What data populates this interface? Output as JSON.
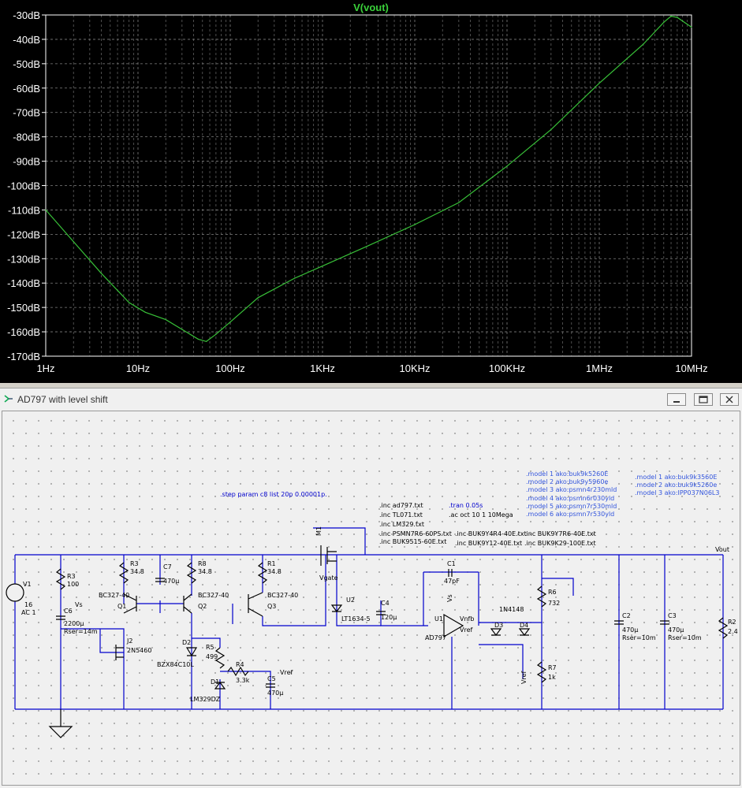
{
  "plot": {
    "title": "V(vout)",
    "trace_color": "#38c038",
    "background": "#000000",
    "y_ticks": [
      "-30dB",
      "-40dB",
      "-50dB",
      "-60dB",
      "-70dB",
      "-80dB",
      "-90dB",
      "-100dB",
      "-110dB",
      "-120dB",
      "-130dB",
      "-140dB",
      "-150dB",
      "-160dB",
      "-170dB"
    ],
    "x_ticks": [
      "1Hz",
      "10Hz",
      "100Hz",
      "1KHz",
      "10KHz",
      "100KHz",
      "1MHz",
      "10MHz"
    ]
  },
  "chart_data": {
    "type": "line",
    "title": "V(vout)",
    "xlabel": "",
    "ylabel": "",
    "x_scale": "log",
    "xlim": [
      1,
      10000000
    ],
    "ylim": [
      -170,
      -30
    ],
    "grid": true,
    "series": [
      {
        "name": "V(vout)",
        "x": [
          1,
          2,
          4,
          8,
          12,
          20,
          30,
          45,
          55,
          70,
          100,
          200,
          500,
          1000,
          3000,
          10000,
          30000,
          100000,
          300000,
          1000000,
          3000000,
          5000000,
          6000000,
          7000000,
          10000000
        ],
        "y": [
          -110,
          -123,
          -136,
          -148,
          -152,
          -155,
          -159,
          -163,
          -164,
          -161,
          -156,
          -146,
          -138,
          -133,
          -125,
          -116,
          -107,
          -92,
          -77,
          -58,
          -42,
          -33,
          -30.5,
          -31,
          -35
        ]
      }
    ]
  },
  "window": {
    "title": "AD797 with level shift",
    "minimize": "minimize",
    "maximize": "maximize",
    "close": "close"
  },
  "schematic": {
    "wire_color": "#0000cc",
    "directives": {
      "step": ".step param c8 list 20p 0.00001p.",
      "tran": ".tran 0.05s",
      "ac": ".ac oct 10 1 10Mega",
      "inc1": ".inc ad797.txt",
      "inc2": ".inc TL071.txt",
      "inc3": ".inc LM329.txt",
      "inc4": ".inc PSMN7R6-60PS.txt",
      "inc5": ".inc BUK9515-60E.txt",
      "inc6": ".inc BUK9Y4R4-40E.txt",
      "inc7": ".inc BUK9Y12-40E.txt",
      "inc8": ".inc BUK9Y7R6-40E.txt",
      "inc9": ".inc BUK9K29-100E.txt",
      "models_a": [
        ".model 1 ako:buk9k5260E",
        ".model 2 ako:buk9y5960e",
        ".model 3 ako:psmn4r230mld",
        ".model 4 ako:psmn6r030yld",
        ".model 5 ako:psmn7r530mld",
        ".model 6 ako:psmn7r530yld"
      ],
      "models_b": [
        ".model 1 ako:buk9k3560E",
        ".model 2 ako:buk9k5260e",
        ".model 3 ako:IPP037N06L3"
      ]
    },
    "labels": {
      "v1": "V1",
      "v1_val": "16",
      "v1_ac": "AC 1",
      "r3": "R3",
      "r3_val": "100",
      "c6": "C6",
      "c6_val": "2200µ",
      "c6_rser": "Rser=14m",
      "vs_flag": "Vs",
      "r3b": "R3",
      "r3b_val": "34.8",
      "c7": "C7",
      "c7_val": "470µ",
      "r8": "R8",
      "r8_val": "34.8",
      "r1": "R1",
      "r1_val": "34.8",
      "q1_part": "BC327-40",
      "q1": "Q1",
      "q2_part": "BC327-40",
      "q2": "Q2",
      "q3_part": "BC327-40",
      "q3": "Q3",
      "j2": "J2",
      "j2_part": "2N5460",
      "d2": "D2",
      "d2_part": "BZX84C10L",
      "r5": "R5",
      "r5_val": "499",
      "r4": "R4",
      "r4_val": "3.3k",
      "d1": "D1",
      "d1_part": "LM329DZ",
      "c5": "C5",
      "c5_val": "470µ",
      "vref_flag": "Vref",
      "m1": "M1",
      "vgate": "Vgate",
      "u2": "U2",
      "u2_part": "LT1634-5",
      "c4": "C4",
      "c4_val": "120µ",
      "c1": "C1",
      "c1_val": "47pF",
      "u1": "U1",
      "u1_part": "AD797",
      "vs2": "Vs",
      "vnfb": "Vnfb",
      "vref2": "Vref",
      "d3": "D3",
      "d4": "D4",
      "d_part": "1N4148",
      "vref3": "Vref",
      "r6": "R6",
      "r6_val": "732",
      "r7": "R7",
      "r7_val": "1k",
      "c2": "C2",
      "c2_val": "470µ",
      "c2_rser": "Rser=10m",
      "c3": "C3",
      "c3_val": "470µ",
      "c3_rser": "Rser=10m",
      "r2": "R2",
      "r2_val": "2.4",
      "vout": "Vout"
    }
  }
}
